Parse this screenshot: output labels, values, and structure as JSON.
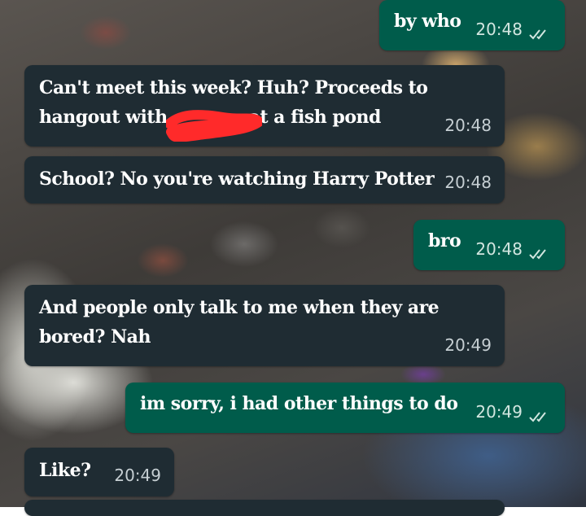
{
  "messages": [
    {
      "id": "m1",
      "dir": "out",
      "text": "by who",
      "time": "20:48",
      "status": "read"
    },
    {
      "id": "m2",
      "dir": "in",
      "text_line1": "Can't meet this week? Huh? Proceeds to",
      "text_line2_a": "hangout with",
      "text_line2_b": "at a fish pond",
      "time": "20:48"
    },
    {
      "id": "m3",
      "dir": "in",
      "text": "School? No you're watching Harry Potter",
      "time": "20:48"
    },
    {
      "id": "m4",
      "dir": "out",
      "text": "bro",
      "time": "20:48",
      "status": "read"
    },
    {
      "id": "m5",
      "dir": "in",
      "text_line1": "And people only talk to me when they are",
      "text_line2": "bored? Nah",
      "time": "20:49"
    },
    {
      "id": "m6",
      "dir": "out",
      "text": "im sorry, i had other things to do",
      "time": "20:49",
      "status": "read"
    },
    {
      "id": "m7",
      "dir": "in",
      "text": "Like?",
      "time": "20:49"
    }
  ],
  "colors": {
    "incoming_bubble": "#1f2c33",
    "outgoing_bubble": "#005c4b",
    "read_tick": "#d2e6e0",
    "redaction": "#ff2a2a"
  },
  "icons": {
    "read_receipt": "double-check-icon",
    "redaction": "red-scribble"
  }
}
